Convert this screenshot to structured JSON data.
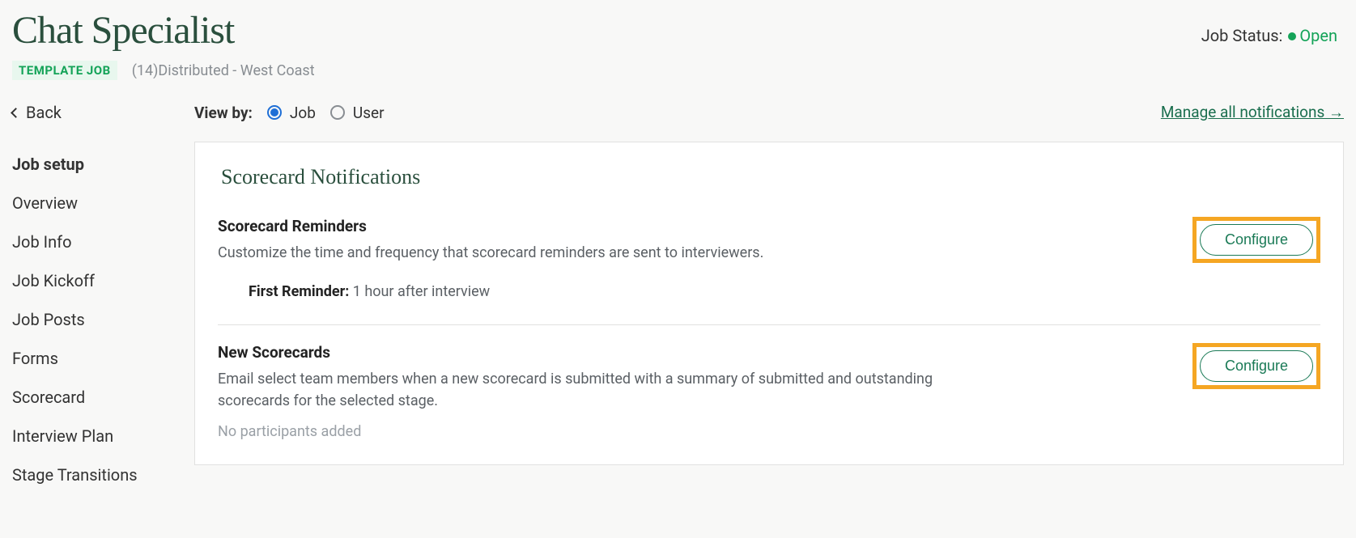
{
  "header": {
    "title": "Chat Specialist",
    "template_badge": "TEMPLATE JOB",
    "req_location": "(14)Distributed - West Coast",
    "status_label": "Job Status:",
    "status_value": "Open"
  },
  "sidebar": {
    "back": "Back",
    "items": [
      {
        "label": "Job setup",
        "current": true
      },
      {
        "label": "Overview"
      },
      {
        "label": "Job Info"
      },
      {
        "label": "Job Kickoff"
      },
      {
        "label": "Job Posts"
      },
      {
        "label": "Forms"
      },
      {
        "label": "Scorecard"
      },
      {
        "label": "Interview Plan"
      },
      {
        "label": "Stage Transitions"
      }
    ]
  },
  "filter": {
    "label": "View by:",
    "options": {
      "job": "Job",
      "user": "User"
    },
    "manage_link": "Manage all notifications →"
  },
  "panel": {
    "title": "Scorecard Notifications",
    "sections": {
      "reminders": {
        "title": "Scorecard Reminders",
        "desc": "Customize the time and frequency that scorecard reminders are sent to interviewers.",
        "first_reminder_label": "First Reminder:",
        "first_reminder_value": "1 hour after interview",
        "configure": "Configure"
      },
      "new_scorecards": {
        "title": "New Scorecards",
        "desc": "Email select team members when a new scorecard is submitted with a summary of submitted and outstanding scorecards for the selected stage.",
        "no_participants": "No participants added",
        "configure": "Configure"
      }
    }
  }
}
